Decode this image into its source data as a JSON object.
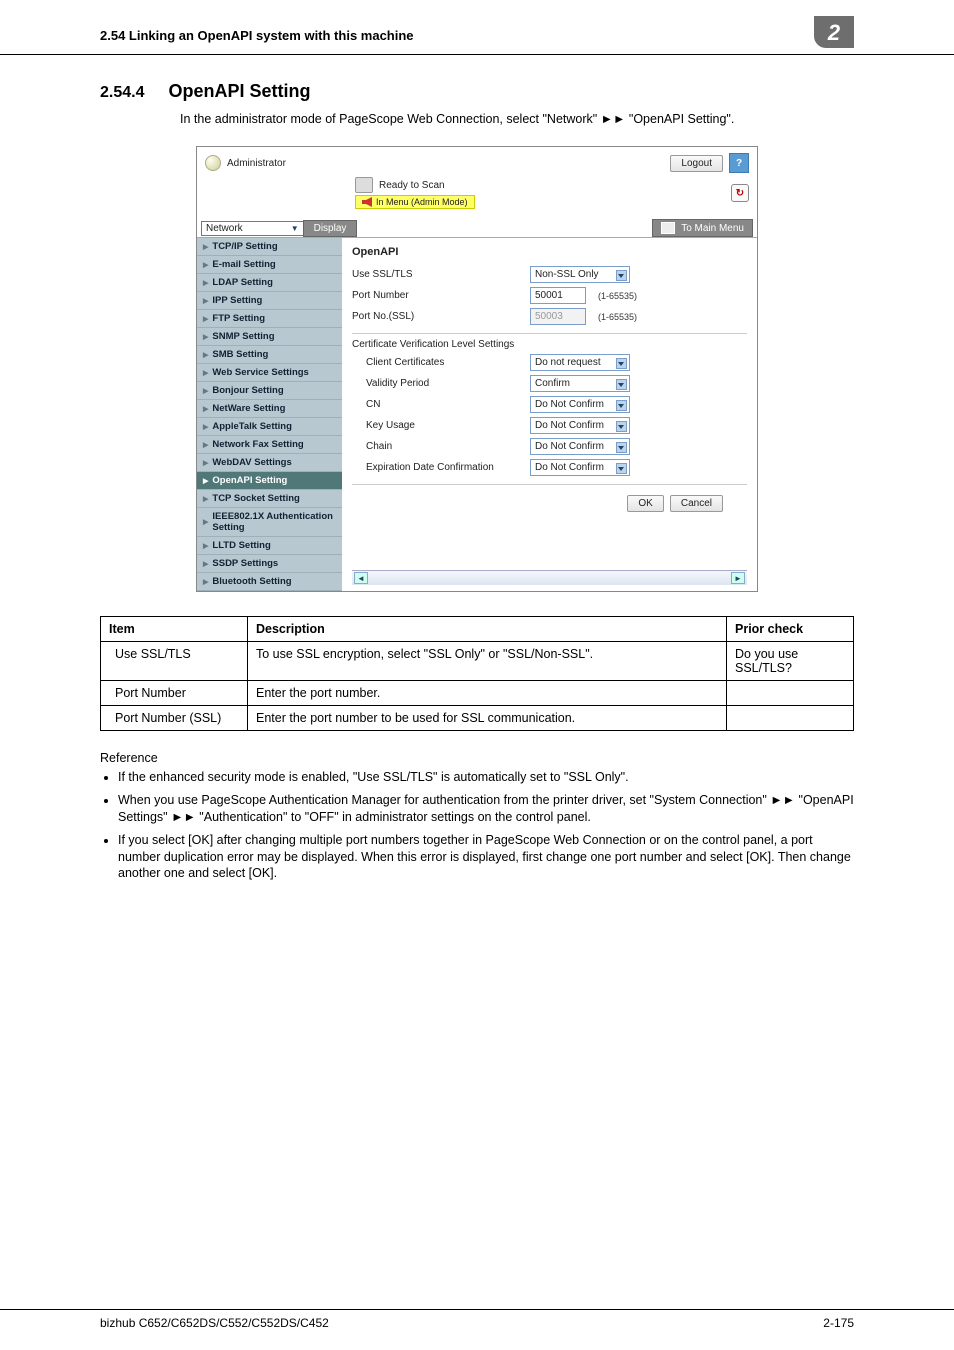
{
  "header": {
    "section_label": "2.54    Linking an OpenAPI system with this machine",
    "chapter": "2"
  },
  "section": {
    "number": "2.54.4",
    "title": "OpenAPI Setting",
    "intro": "In the administrator mode of PageScope Web Connection, select \"Network\" ►► \"OpenAPI Setting\"."
  },
  "shot": {
    "administrator": "Administrator",
    "logout": "Logout",
    "help": "?",
    "ready": "Ready to Scan",
    "admin_mode": "In Menu (Admin Mode)",
    "network": "Network",
    "display": "Display",
    "to_main_menu": "To Main Menu",
    "sidebar": [
      "TCP/IP Setting",
      "E-mail Setting",
      "LDAP Setting",
      "IPP Setting",
      "FTP Setting",
      "SNMP Setting",
      "SMB Setting",
      "Web Service Settings",
      "Bonjour Setting",
      "NetWare Setting",
      "AppleTalk Setting",
      "Network Fax Setting",
      "WebDAV Settings",
      "OpenAPI Setting",
      "TCP Socket Setting",
      "IEEE802.1X Authentication Setting",
      "LLTD Setting",
      "SSDP Settings",
      "Bluetooth Setting"
    ],
    "active_index": 13,
    "panel_title": "OpenAPI",
    "rows": {
      "use_ssl": {
        "label": "Use SSL/TLS",
        "value": "Non-SSL Only"
      },
      "port": {
        "label": "Port Number",
        "value": "50001",
        "hint": "(1-65535)"
      },
      "port_ssl": {
        "label": "Port No.(SSL)",
        "value": "50003",
        "hint": "(1-65535)"
      },
      "cert_head": "Certificate Verification Level Settings",
      "client_cert": {
        "label": "Client Certificates",
        "value": "Do not request"
      },
      "validity": {
        "label": "Validity Period",
        "value": "Confirm"
      },
      "cn": {
        "label": "CN",
        "value": "Do Not Confirm"
      },
      "key_usage": {
        "label": "Key Usage",
        "value": "Do Not Confirm"
      },
      "chain": {
        "label": "Chain",
        "value": "Do Not Confirm"
      },
      "exp": {
        "label": "Expiration Date Confirmation",
        "value": "Do Not Confirm"
      }
    },
    "ok": "OK",
    "cancel": "Cancel"
  },
  "table": {
    "headers": {
      "item": "Item",
      "desc": "Description",
      "prior": "Prior check"
    },
    "rows": [
      {
        "item": "Use SSL/TLS",
        "desc": "To use SSL encryption, select \"SSL Only\" or \"SSL/Non-SSL\".",
        "prior": "Do you use SSL/TLS?"
      },
      {
        "item": "Port Number",
        "desc": "Enter the port number.",
        "prior": ""
      },
      {
        "item": "Port Number (SSL)",
        "desc": "Enter the port number to be used for SSL communication.",
        "prior": ""
      }
    ]
  },
  "reference": {
    "title": "Reference",
    "bullets": [
      "If the enhanced security mode is enabled, \"Use SSL/TLS\" is automatically set to \"SSL Only\".",
      "When you use PageScope Authentication Manager for authentication from the printer driver, set \"System Connection\" ►► \"OpenAPI Settings\" ►► \"Authentication\" to \"OFF\" in administrator settings on the control panel.",
      "If you select [OK] after changing multiple port numbers together in PageScope Web Connection or on the control panel, a port number duplication error may be displayed. When this error is displayed, first change one port number and select [OK]. Then change another one and select [OK]."
    ]
  },
  "footer": {
    "left": "bizhub C652/C652DS/C552/C552DS/C452",
    "right": "2-175"
  }
}
